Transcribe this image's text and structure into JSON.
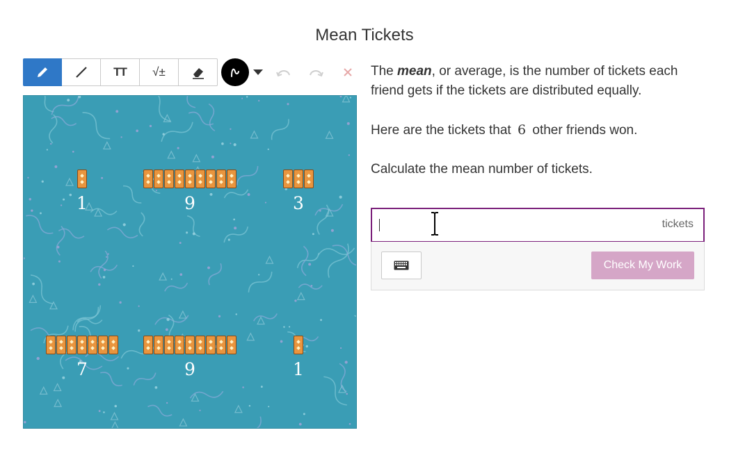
{
  "page": {
    "title": "Mean Tickets"
  },
  "toolbar": {
    "tools": [
      "pencil-icon",
      "line-icon",
      "text-size-icon",
      "math-icon",
      "eraser-icon"
    ],
    "text_tool_label": "TT",
    "math_tool_label": "√±",
    "color": "#000000",
    "active_tool": "pencil"
  },
  "prompt": {
    "p1_before": "The ",
    "p1_em": "mean",
    "p1_after": ", or average, is the number of tickets each friend gets if the tickets are distributed equally.",
    "p2_before": "Here are the tickets that",
    "p2_num": "6",
    "p2_after": "other friends won.",
    "p3": "Calculate the mean number of tickets."
  },
  "answer": {
    "value": "",
    "unit": "tickets"
  },
  "footer": {
    "check_label": "Check My Work"
  },
  "ticket_groups": [
    {
      "count": 1,
      "label": "1"
    },
    {
      "count": 9,
      "label": "9"
    },
    {
      "count": 3,
      "label": "3"
    },
    {
      "count": 7,
      "label": "7"
    },
    {
      "count": 9,
      "label": "9"
    },
    {
      "count": 1,
      "label": "1"
    }
  ],
  "colors": {
    "accent": "#2f78c7",
    "canvas": "#3a9db5",
    "answer_border": "#7a1f7a",
    "check_button": "#d5a6c7"
  }
}
